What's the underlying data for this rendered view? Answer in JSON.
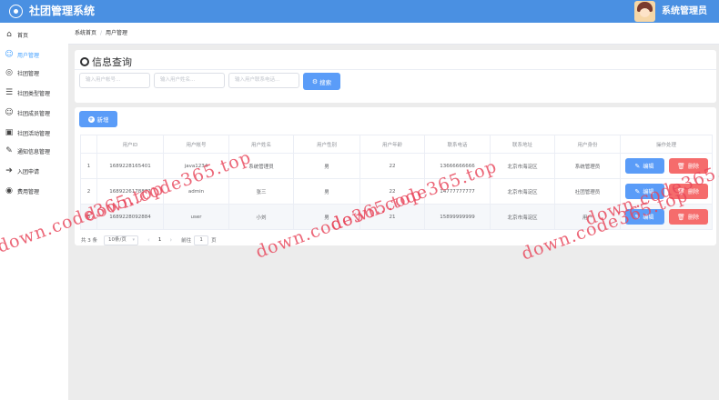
{
  "app": {
    "title": "社团管理系统",
    "user_name": "系统管理员"
  },
  "sidebar": {
    "items": [
      {
        "label": "首页",
        "icon": "home-icon",
        "glyph": "⌂",
        "active": false
      },
      {
        "label": "用户管理",
        "icon": "user-icon",
        "glyph": "☺",
        "active": true
      },
      {
        "label": "社团管理",
        "icon": "club-icon",
        "glyph": "◎",
        "active": false
      },
      {
        "label": "社团类型管理",
        "icon": "list-icon",
        "glyph": "☰",
        "active": false
      },
      {
        "label": "社团成员管理",
        "icon": "member-icon",
        "glyph": "☺",
        "active": false
      },
      {
        "label": "社团活动管理",
        "icon": "activity-icon",
        "glyph": "▣",
        "active": false
      },
      {
        "label": "通知信息管理",
        "icon": "notice-icon",
        "glyph": "✎",
        "active": false
      },
      {
        "label": "入团申请",
        "icon": "apply-icon",
        "glyph": "➔",
        "active": false
      },
      {
        "label": "费用管理",
        "icon": "fee-icon",
        "glyph": "◉",
        "active": false
      }
    ]
  },
  "breadcrumb": {
    "home": "系统首页",
    "separator": "/",
    "current": "用户管理"
  },
  "query": {
    "title": "信息查询",
    "placeholders": {
      "account": "输入用户帐号...",
      "name": "输入用户姓名...",
      "phone": "输入用户联系电话..."
    },
    "search_label": "搜索"
  },
  "toolbar": {
    "add_label": "新增"
  },
  "table": {
    "columns": [
      "",
      "用户ID",
      "用户帐号",
      "用户姓名",
      "用户性别",
      "用户年龄",
      "联系电话",
      "联系地址",
      "用户身份",
      "操作处理"
    ],
    "rows": [
      {
        "index": "1",
        "id": "1689228165401",
        "account": "java1234",
        "name": "系统管理员",
        "gender": "男",
        "age": "22",
        "phone": "13666666666",
        "address": "北京市海淀区",
        "role": "系统管理员"
      },
      {
        "index": "2",
        "id": "1689226178877",
        "account": "admin",
        "name": "张三",
        "gender": "男",
        "age": "22",
        "phone": "14777777777",
        "address": "北京市海淀区",
        "role": "社团管理员"
      },
      {
        "index": "3",
        "id": "1689228092884",
        "account": "user",
        "name": "小刘",
        "gender": "男",
        "age": "21",
        "phone": "15899999999",
        "address": "北京市海淀区",
        "role": "用户"
      }
    ],
    "edit_label": "编辑",
    "delete_label": "删除"
  },
  "pagination": {
    "total": "共 3 条",
    "page_size": "10条/页",
    "current_page": "1",
    "goto_label": "前往",
    "goto_value": "1",
    "page_suffix": "页"
  },
  "watermark": "down.code365.top",
  "colors": {
    "header": "#4a90e2",
    "primary_button": "#5a9cf8",
    "danger_button": "#f56c6c",
    "active_menu": "#409eff"
  }
}
